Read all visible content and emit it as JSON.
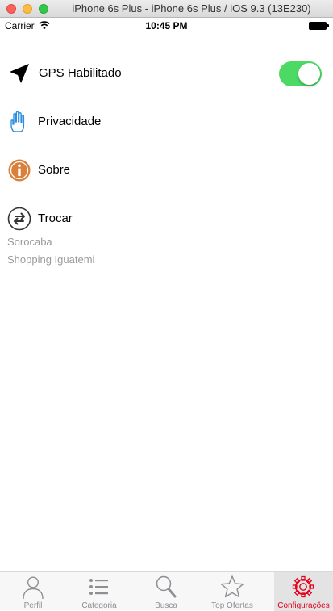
{
  "window": {
    "title": "iPhone 6s Plus - iPhone 6s Plus / iOS 9.3 (13E230)"
  },
  "status_bar": {
    "carrier": "Carrier",
    "time": "10:45 PM"
  },
  "settings": {
    "gps": {
      "label": "GPS Habilitado",
      "enabled": true,
      "icon": "location-arrow-icon"
    },
    "privacy": {
      "label": "Privacidade",
      "icon": "hand-icon"
    },
    "about": {
      "label": "Sobre",
      "icon": "info-icon"
    },
    "switch_location": {
      "label": "Trocar",
      "icon": "swap-icon",
      "city": "Sorocaba",
      "mall": "Shopping Iguatemi"
    }
  },
  "tab_bar": {
    "active": "Configurações",
    "active_color": "#e3001b",
    "tabs": [
      {
        "label": "Perfil",
        "icon": "person-icon"
      },
      {
        "label": "Categoria",
        "icon": "list-icon"
      },
      {
        "label": "Busca",
        "icon": "search-icon"
      },
      {
        "label": "Top Ofertas",
        "icon": "star-icon"
      },
      {
        "label": "Configurações",
        "icon": "gear-icon"
      }
    ]
  }
}
